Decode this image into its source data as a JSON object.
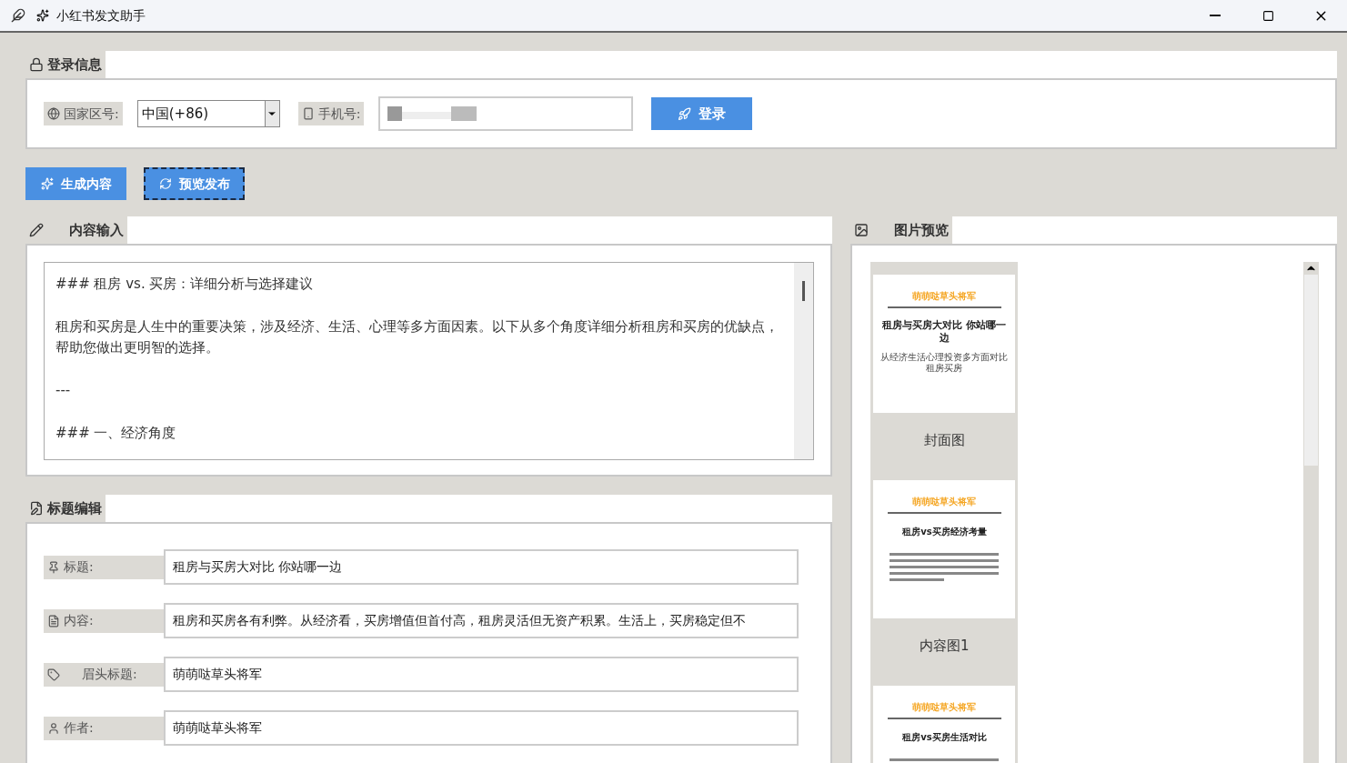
{
  "window": {
    "title": "小红书发文助手"
  },
  "login": {
    "heading": "登录信息",
    "country_label": "国家区号:",
    "country_value": "中国(+86)",
    "phone_label": "手机号:",
    "login_button": "登录"
  },
  "actions": [
    {
      "label": "生成内容",
      "focused": false
    },
    {
      "label": "预览发布",
      "focused": true
    }
  ],
  "content_input": {
    "heading": "内容输入",
    "paragraphs": [
      "### 租房 vs. 买房：详细分析与选择建议",
      "租房和买房是人生中的重要决策，涉及经济、生活、心理等多方面因素。以下从多个角度详细分析租房和买房的优缺点，帮助您做出更明智的选择。",
      "---",
      "### 一、经济角度"
    ]
  },
  "title_edit": {
    "heading": "标题编辑",
    "fields": [
      {
        "label": "标题:",
        "value": "租房与买房大对比 你站哪一边"
      },
      {
        "label": "内容:",
        "value": "租房和买房各有利弊。从经济看，买房增值但首付高，租房灵活但无资产积累。生活上，买房稳定但不"
      },
      {
        "label": "眉头标题:",
        "value": "萌萌哒草头将军"
      },
      {
        "label": "作者:",
        "value": "萌萌哒草头将军"
      }
    ]
  },
  "preview": {
    "heading": "图片预览",
    "images": [
      {
        "kind": "cover",
        "brand": "萌萌哒草头将军",
        "title": "租房与买房大对比 你站哪一边",
        "subtitle": "从经济生活心理投资多方面对比租房买房",
        "caption": "封面图"
      },
      {
        "kind": "content",
        "brand": "萌萌哒草头将军",
        "title": "租房vs买房经济考量",
        "caption": "内容图1"
      },
      {
        "kind": "content",
        "brand": "萌萌哒草头将军",
        "title": "租房vs买房生活对比"
      }
    ]
  }
}
